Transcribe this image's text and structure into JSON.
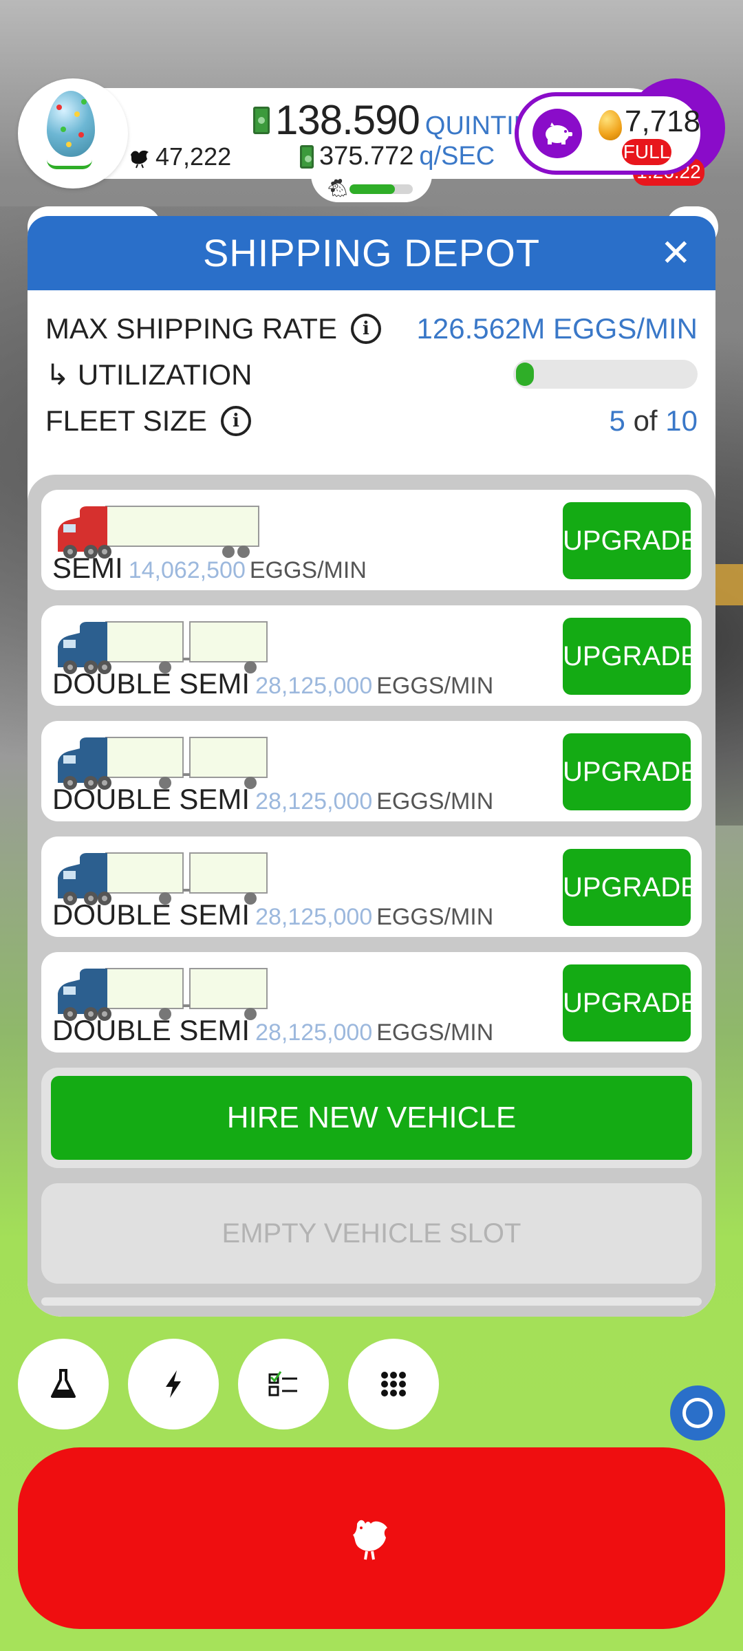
{
  "hud": {
    "chicken_count": "47,222",
    "money_value": "138.590",
    "money_unit": "QUINTILLION",
    "rate_value": "375.772",
    "rate_unit": "q/SEC",
    "golden_eggs": "7,718",
    "piggy_status": "FULL",
    "timer": "1:26:22",
    "progress_fraction": 0.72
  },
  "panel": {
    "title": "SHIPPING DEPOT",
    "close_label": "✕",
    "max_shipping_label": "MAX SHIPPING RATE",
    "max_shipping_value": "126.562M EGGS/MIN",
    "utilization_label": "↳ UTILIZATION",
    "utilization_fraction": 0.04,
    "fleet_size_label": "FLEET SIZE",
    "fleet_current": "5",
    "fleet_of": "of",
    "fleet_max": "10"
  },
  "vehicles": [
    {
      "name": "SEMI",
      "rate": "14,062,500",
      "unit": "EGGS/MIN",
      "button": "UPGRADE",
      "cab_color": "#d6302e"
    },
    {
      "name": "DOUBLE SEMI",
      "rate": "28,125,000",
      "unit": "EGGS/MIN",
      "button": "UPGRADE",
      "cab_color": "#2c5f8f"
    },
    {
      "name": "DOUBLE SEMI",
      "rate": "28,125,000",
      "unit": "EGGS/MIN",
      "button": "UPGRADE",
      "cab_color": "#2c5f8f"
    },
    {
      "name": "DOUBLE SEMI",
      "rate": "28,125,000",
      "unit": "EGGS/MIN",
      "button": "UPGRADE",
      "cab_color": "#2c5f8f"
    },
    {
      "name": "DOUBLE SEMI",
      "rate": "28,125,000",
      "unit": "EGGS/MIN",
      "button": "UPGRADE",
      "cab_color": "#2c5f8f"
    }
  ],
  "hire_label": "HIRE NEW VEHICLE",
  "empty_slot_label": "EMPTY VEHICLE SLOT",
  "bottom_buttons": [
    {
      "icon": "flask-icon"
    },
    {
      "icon": "lightning-icon"
    },
    {
      "icon": "checklist-icon"
    },
    {
      "icon": "grid-menu-icon"
    }
  ],
  "colors": {
    "header_blue": "#2a6fc9",
    "upgrade_green": "#14ab14",
    "hatch_red": "#ef0e10",
    "accent_purple": "#8a0cc9"
  }
}
